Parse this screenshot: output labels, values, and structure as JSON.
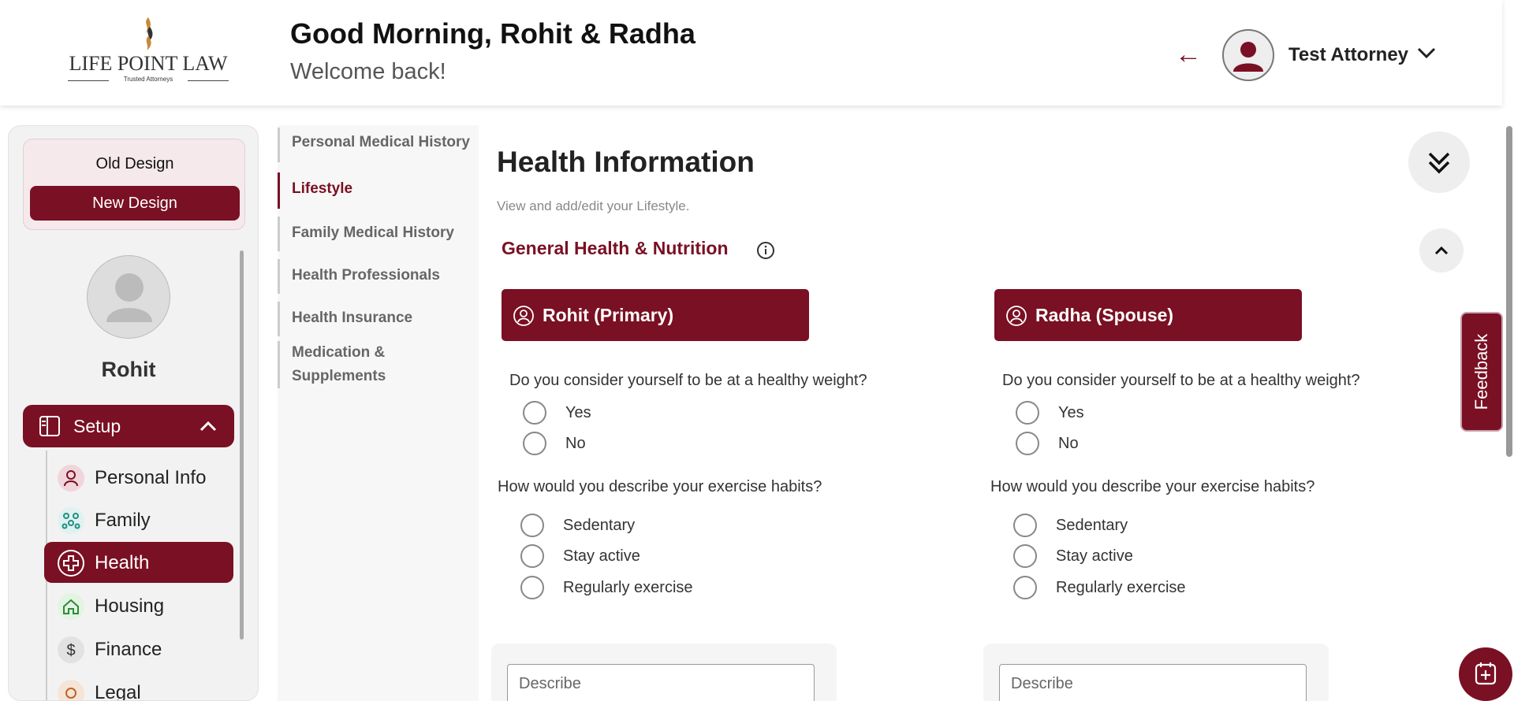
{
  "header": {
    "logo": {
      "name": "LIFE POINT LAW",
      "tagline": "Trusted Attorneys"
    },
    "greeting": "Good Morning, Rohit & Radha",
    "welcome": "Welcome back!",
    "back_arrow": "←",
    "user_name": "Test Attorney"
  },
  "sidebar": {
    "old_design": "Old Design",
    "new_design": "New Design",
    "profile_name": "Rohit",
    "setup_label": "Setup",
    "items": [
      {
        "label": "Personal Info",
        "icon": "person-icon",
        "active": false
      },
      {
        "label": "Family",
        "icon": "family-icon",
        "active": false
      },
      {
        "label": "Health",
        "icon": "health-cross-icon",
        "active": true
      },
      {
        "label": "Housing",
        "icon": "home-icon",
        "active": false
      },
      {
        "label": "Finance",
        "icon": "dollar-icon",
        "active": false
      },
      {
        "label": "Legal",
        "icon": "legal-icon",
        "active": false
      }
    ]
  },
  "subnav": {
    "items": [
      {
        "label": "Personal Medical History",
        "active": false
      },
      {
        "label": "Lifestyle",
        "active": true
      },
      {
        "label": "Family Medical History",
        "active": false
      },
      {
        "label": "Health Professionals",
        "active": false
      },
      {
        "label": "Health Insurance",
        "active": false
      },
      {
        "label": "Medication &",
        "label2": "Supplements",
        "active": false
      }
    ]
  },
  "main": {
    "title": "Health Information",
    "subtitle": "View and add/edit your Lifestyle.",
    "section_title": "General Health & Nutrition",
    "columns": [
      {
        "name": "Rohit (Primary)",
        "q1": "Do you consider yourself to be at a healthy weight?",
        "q1_options": [
          "Yes",
          "No"
        ],
        "q2": "How would you describe your exercise habits?",
        "q2_options": [
          "Sedentary",
          "Stay active",
          "Regularly exercise"
        ],
        "describe_placeholder": "Describe"
      },
      {
        "name": "Radha (Spouse)",
        "q1": "Do you consider yourself to be at a healthy weight?",
        "q1_options": [
          "Yes",
          "No"
        ],
        "q2": "How would you describe your exercise habits?",
        "q2_options": [
          "Sedentary",
          "Stay active",
          "Regularly exercise"
        ],
        "describe_placeholder": "Describe"
      }
    ]
  },
  "feedback_label": "Feedback",
  "colors": {
    "brand": "#7a1023",
    "active_bg": "#7a1023"
  }
}
